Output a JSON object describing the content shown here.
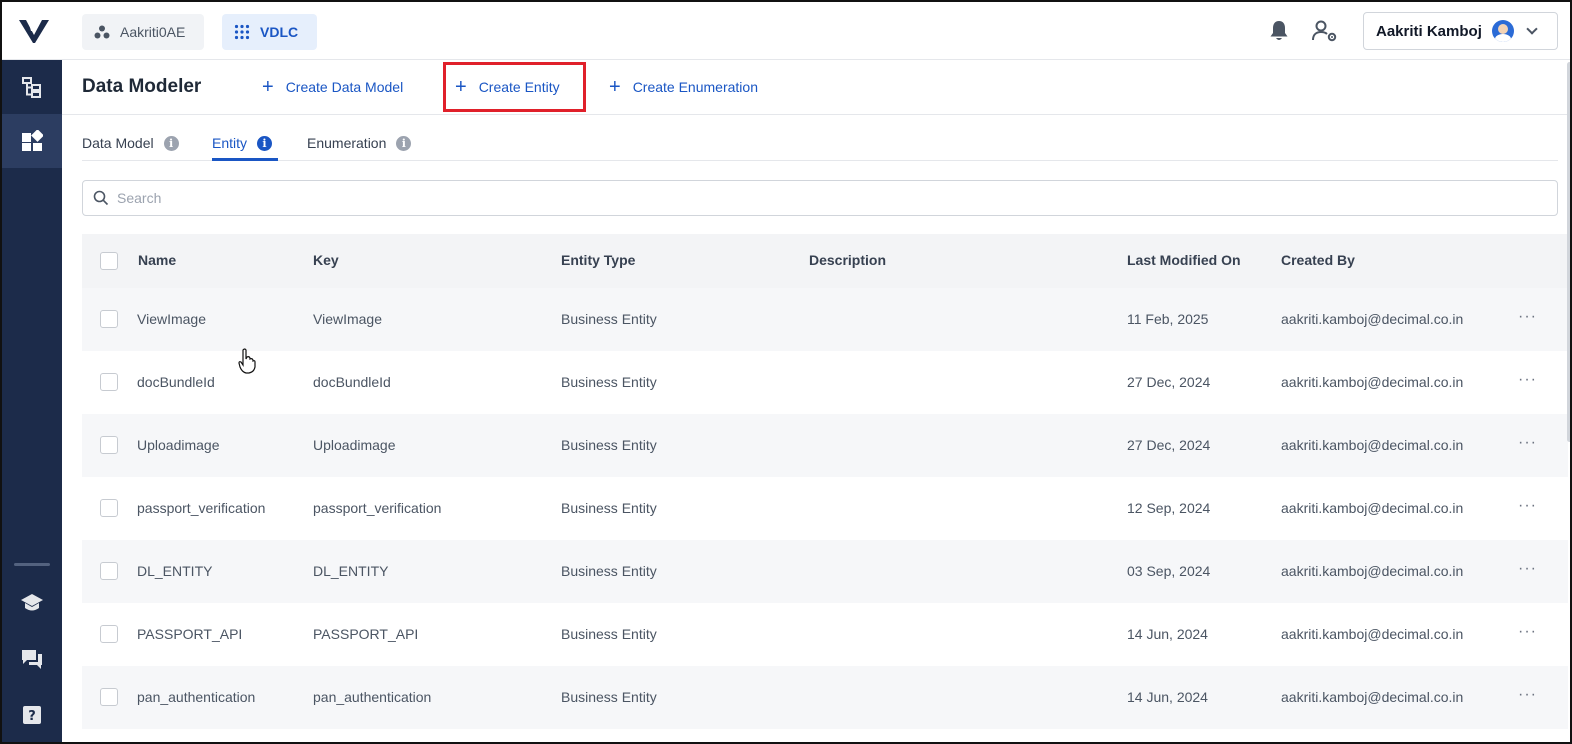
{
  "topbar": {
    "workspace_org": "Aakriti0AE",
    "workspace_app": "VDLC",
    "user_name": "Aakriti Kamboj"
  },
  "sidebar": {
    "items": [
      "hierarchy-icon",
      "widgets-icon",
      "graduation-cap-icon",
      "chat-icon",
      "help-icon"
    ]
  },
  "header": {
    "title": "Data Modeler",
    "actions": [
      {
        "label": "Create Data Model"
      },
      {
        "label": "Create Entity"
      },
      {
        "label": "Create Enumeration"
      }
    ]
  },
  "tabs": [
    {
      "label": "Data Model",
      "active": false
    },
    {
      "label": "Entity",
      "active": true
    },
    {
      "label": "Enumeration",
      "active": false
    }
  ],
  "search": {
    "placeholder": "Search",
    "value": ""
  },
  "table": {
    "columns": [
      "Name",
      "Key",
      "Entity Type",
      "Description",
      "Last Modified On",
      "Created By"
    ],
    "rows": [
      {
        "name": "ViewImage",
        "key": "ViewImage",
        "type": "Business Entity",
        "description": "",
        "modified": "11 Feb, 2025",
        "created_by": "aakriti.kamboj@decimal.co.in"
      },
      {
        "name": "docBundleId",
        "key": "docBundleId",
        "type": "Business Entity",
        "description": "",
        "modified": "27 Dec, 2024",
        "created_by": "aakriti.kamboj@decimal.co.in"
      },
      {
        "name": "Uploadimage",
        "key": "Uploadimage",
        "type": "Business Entity",
        "description": "",
        "modified": "27 Dec, 2024",
        "created_by": "aakriti.kamboj@decimal.co.in"
      },
      {
        "name": "passport_verification",
        "key": "passport_verification",
        "type": "Business Entity",
        "description": "",
        "modified": "12 Sep, 2024",
        "created_by": "aakriti.kamboj@decimal.co.in"
      },
      {
        "name": "DL_ENTITY",
        "key": "DL_ENTITY",
        "type": "Business Entity",
        "description": "",
        "modified": "03 Sep, 2024",
        "created_by": "aakriti.kamboj@decimal.co.in"
      },
      {
        "name": "PASSPORT_API",
        "key": "PASSPORT_API",
        "type": "Business Entity",
        "description": "",
        "modified": "14 Jun, 2024",
        "created_by": "aakriti.kamboj@decimal.co.in"
      },
      {
        "name": "pan_authentication",
        "key": "pan_authentication",
        "type": "Business Entity",
        "description": "",
        "modified": "14 Jun, 2024",
        "created_by": "aakriti.kamboj@decimal.co.in"
      }
    ]
  },
  "colors": {
    "accent": "#1a56c4",
    "sidebar": "#1c2b4a",
    "highlight": "#e0202a"
  }
}
